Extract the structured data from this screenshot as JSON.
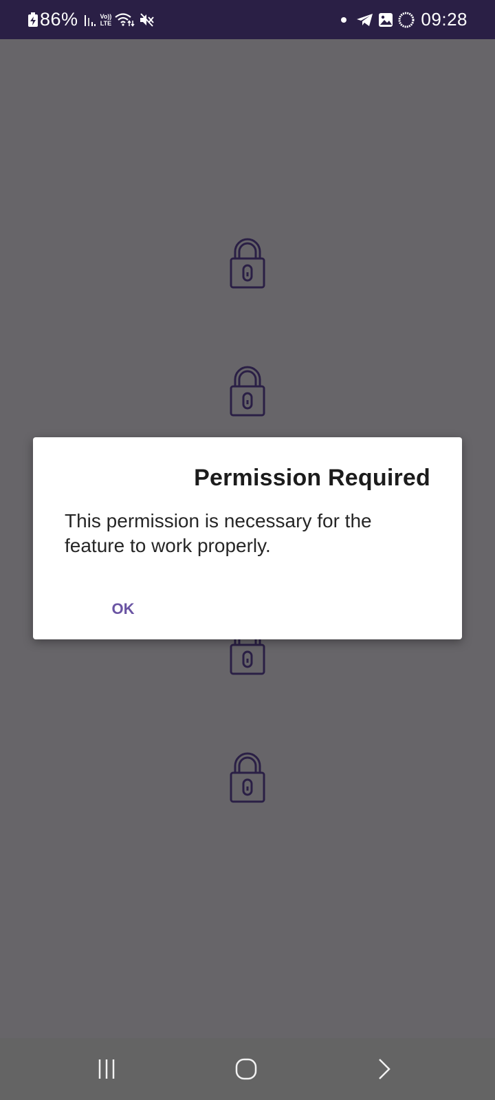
{
  "status_bar": {
    "battery_percent": "86%",
    "volte_top": "Vo))",
    "volte_bottom": "LTE",
    "time": "09:28",
    "icons": [
      "battery-charging-icon",
      "signal-bars-icon",
      "volte-icon",
      "wifi-icon",
      "mute-icon",
      "notification-dot-icon",
      "telegram-icon",
      "gallery-icon",
      "ring-icon"
    ]
  },
  "background": {
    "lock_icons": [
      "lock-icon",
      "lock-icon",
      "lock-icon",
      "lock-icon"
    ],
    "lock_color": "#2a1f45",
    "scrim_color": "#676569"
  },
  "dialog": {
    "title": "Permission Required",
    "message": "This permission is necessary for the feature to work properly.",
    "ok_label": "OK",
    "accent_color": "#6a54a3"
  },
  "nav_bar": {
    "buttons": [
      "recents-icon",
      "home-icon",
      "back-icon"
    ]
  }
}
